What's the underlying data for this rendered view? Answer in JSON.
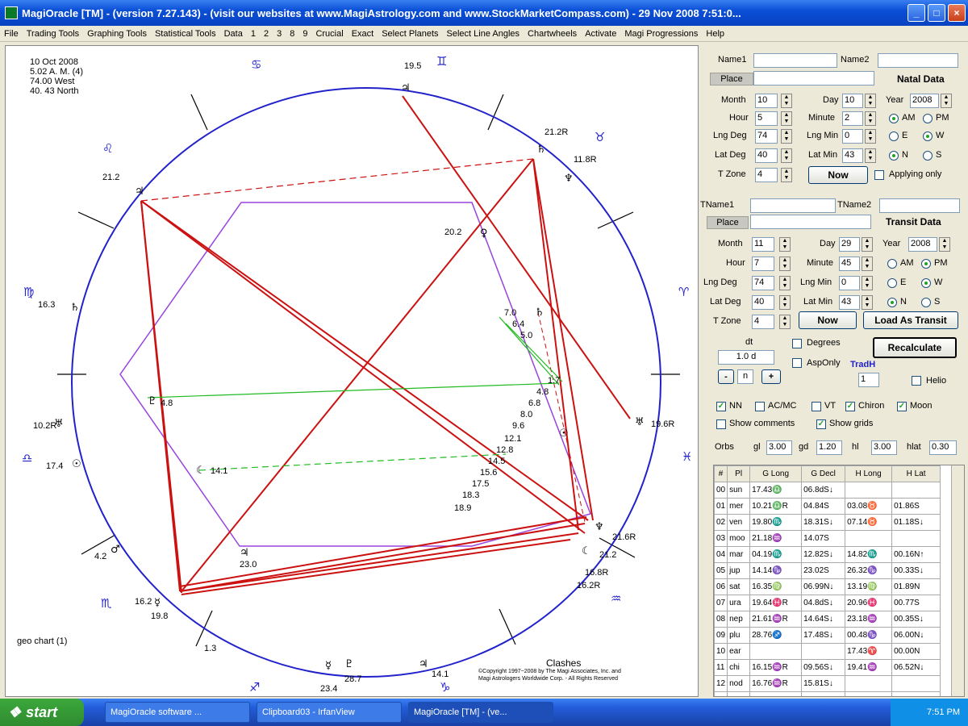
{
  "titlebar": {
    "title": "MagiOracle [TM] - (version 7.27.143) - (visit our websites at www.MagiAstrology.com and www.StockMarketCompass.com) - 29 Nov 2008   7:51:0...",
    "minimize": "_",
    "maximize": "□",
    "close": "×"
  },
  "menu": [
    "File",
    "Trading Tools",
    "Graphing Tools",
    "Statistical Tools",
    "Data",
    "1",
    "2",
    "3",
    "8",
    "9",
    "Crucial",
    "Exact",
    "Select Planets",
    "Select Line Angles",
    "Chartwheels",
    "Activate",
    "Magi Progressions",
    "Help"
  ],
  "chart_info": {
    "date": "10 Oct 2008",
    "time": "5.02 A. M. (4)",
    "longitude": "74.00 West",
    "latitude": "40. 43 North",
    "caption": "geo chart (1)",
    "clashes": "Clashes",
    "copyright1": "©Copyright 1997~2008 by The Magi Associates, Inc. and",
    "copyright2": "Magi Astrologers Worldwide Corp. - All Rights Reserved"
  },
  "wheel_labels": [
    {
      "t": "19.5"
    },
    {
      "t": "21.2R"
    },
    {
      "t": "11.8R"
    },
    {
      "t": "21.2"
    },
    {
      "t": "20.2"
    },
    {
      "t": "16.3"
    },
    {
      "t": "7.0"
    },
    {
      "t": "6.4"
    },
    {
      "t": "5.0"
    },
    {
      "t": "4.8"
    },
    {
      "t": "4.8"
    },
    {
      "t": "6.8"
    },
    {
      "t": "8.0"
    },
    {
      "t": "9.6"
    },
    {
      "t": "12.1"
    },
    {
      "t": "12.8"
    },
    {
      "t": "14.5"
    },
    {
      "t": "15.6"
    },
    {
      "t": "17.5"
    },
    {
      "t": "18.3"
    },
    {
      "t": "18.9"
    },
    {
      "t": "19.6R"
    },
    {
      "t": "10.2R"
    },
    {
      "t": "17.4"
    },
    {
      "t": "14.1"
    },
    {
      "t": "21.6R"
    },
    {
      "t": "21.2"
    },
    {
      "t": "16.8R"
    },
    {
      "t": "16.2R"
    },
    {
      "t": "23.0"
    },
    {
      "t": "4.2"
    },
    {
      "t": "16.2"
    },
    {
      "t": "19.8"
    },
    {
      "t": "1.3"
    },
    {
      "t": "28.7"
    },
    {
      "t": "23.4"
    },
    {
      "t": "14.1"
    },
    {
      "t": "1.7"
    }
  ],
  "natal": {
    "name1_label": "Name1",
    "name2_label": "Name2",
    "place_button": "Place",
    "header": "Natal Data",
    "month_label": "Month",
    "month": "10",
    "day_label": "Day",
    "day": "10",
    "year_label": "Year",
    "year": "2008",
    "hour_label": "Hour",
    "hour": "5",
    "minute_label": "Minute",
    "minute": "2",
    "am": "AM",
    "pm": "PM",
    "lngdeg_label": "Lng Deg",
    "lngdeg": "74",
    "lngmin_label": "Lng Min",
    "lngmin": "0",
    "e": "E",
    "w": "W",
    "latdeg_label": "Lat Deg",
    "latdeg": "40",
    "latmin_label": "Lat Min",
    "latmin": "43",
    "n": "N",
    "s": "S",
    "tzone_label": "T Zone",
    "tzone": "4",
    "now_button": "Now",
    "applying_label": "Applying only"
  },
  "transit": {
    "name1_label": "TName1",
    "name2_label": "TName2",
    "place_button": "Place",
    "header": "Transit Data",
    "month_label": "Month",
    "month": "11",
    "day_label": "Day",
    "day": "29",
    "year_label": "Year",
    "year": "2008",
    "hour_label": "Hour",
    "hour": "7",
    "minute_label": "Minute",
    "minute": "45",
    "am": "AM",
    "pm": "PM",
    "lngdeg_label": "Lng Deg",
    "lngdeg": "74",
    "lngmin_label": "Lng Min",
    "lngmin": "0",
    "e": "E",
    "w": "W",
    "latdeg_label": "Lat Deg",
    "latdeg": "40",
    "latmin_label": "Lat Min",
    "latmin": "43",
    "n": "N",
    "s": "S",
    "tzone_label": "T Zone",
    "tzone": "4",
    "now_button": "Now",
    "load_button": "Load As Transit"
  },
  "controls": {
    "dt_label": "dt",
    "dt_value": "1.0 d",
    "minus": "-",
    "n": "n",
    "plus": "+",
    "degrees_label": "Degrees",
    "asponly_label": "AspOnly",
    "tradh_label": "TradH",
    "tradh_value": "1",
    "helio_label": "Helio",
    "recalc_button": "Recalculate",
    "nn_label": "NN",
    "acmc_label": "AC/MC",
    "vt_label": "VT",
    "chiron_label": "Chiron",
    "moon_label": "Moon",
    "comments_label": "Show comments",
    "grids_label": "Show grids",
    "orbs_label": "Orbs",
    "gl_label": "gl",
    "gl": "3.00",
    "gd_label": "gd",
    "gd": "1.20",
    "hl_label": "hl",
    "hl": "3.00",
    "hlat_label": "hlat",
    "hlat": "0.30"
  },
  "planet_table": {
    "headers": [
      "#",
      "Pl",
      "G Long",
      "G Decl",
      "H Long",
      "H Lat"
    ],
    "rows": [
      [
        "00",
        "sun",
        "17.43♎",
        "06.8dS↓",
        "",
        ""
      ],
      [
        "01",
        "mer",
        "10.21♎R",
        "04.84S",
        "03.08♉",
        "01.86S"
      ],
      [
        "02",
        "ven",
        "19.80♏",
        "18.31S↓",
        "07.14♉",
        "01.18S↓"
      ],
      [
        "03",
        "moo",
        "21.18♒",
        "14.07S",
        "",
        ""
      ],
      [
        "04",
        "mar",
        "04.19♏",
        "12.82S↓",
        "14.82♏",
        "00.16N↑"
      ],
      [
        "05",
        "jup",
        "14.14♑",
        "23.02S",
        "26.32♑",
        "00.33S↓"
      ],
      [
        "06",
        "sat",
        "16.35♍",
        "06.99N↓",
        "13.19♍",
        "01.89N"
      ],
      [
        "07",
        "ura",
        "19.64♓R",
        "04.8dS↓",
        "20.96♓",
        "00.77S"
      ],
      [
        "08",
        "nep",
        "21.61♒R",
        "14.64S↓",
        "23.18♒",
        "00.35S↓"
      ],
      [
        "09",
        "plu",
        "28.76♐",
        "17.48S↓",
        "00.48♑",
        "06.00N↓"
      ],
      [
        "10",
        "ear",
        "",
        "",
        "17.43♈",
        "00.00N"
      ],
      [
        "11",
        "chi",
        "16.15♒R",
        "09.56S↓",
        "19.41♒",
        "06.52N↓"
      ],
      [
        "12",
        "nod",
        "16.76♒R",
        "15.81S↓",
        "",
        ""
      ],
      [
        "13",
        "",
        "",
        "",
        "",
        ""
      ]
    ]
  },
  "taskbar": {
    "start": "start",
    "tasks": [
      "MagiOracle software ...",
      "Clipboard03 - IrfanView",
      "MagiOracle [TM] - (ve..."
    ],
    "clock": "7:51 PM"
  },
  "colors": {
    "wheel": "#2222cc",
    "aspect_red": "#cc1111",
    "aspect_purple": "#9944dd",
    "aspect_green": "#22bb22"
  }
}
